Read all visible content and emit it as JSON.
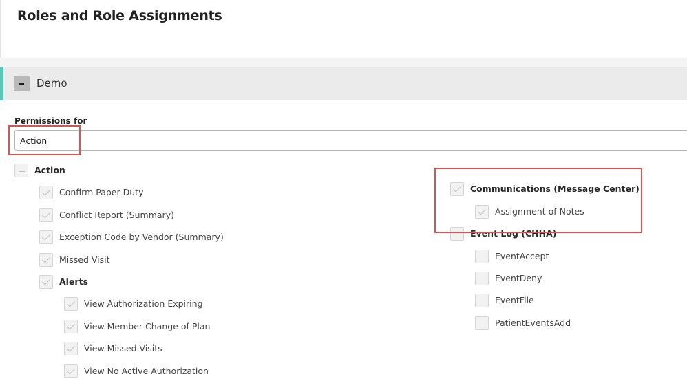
{
  "page": {
    "title": "Roles and Role Assignments"
  },
  "section": {
    "title": "Demo"
  },
  "permissions": {
    "label": "Permissions for",
    "selected": "Action"
  },
  "tree_left": {
    "action": {
      "label": "Action",
      "items": [
        {
          "label": "Confirm Paper Duty",
          "checked": true
        },
        {
          "label": "Conflict Report (Summary)",
          "checked": true
        },
        {
          "label": "Exception Code by Vendor (Summary)",
          "checked": true
        },
        {
          "label": "Missed Visit",
          "checked": true
        }
      ],
      "alerts": {
        "label": "Alerts",
        "items": [
          {
            "label": "View Authorization Expiring",
            "checked": true
          },
          {
            "label": "View Member Change of Plan",
            "checked": true
          },
          {
            "label": "View Missed Visits",
            "checked": true
          },
          {
            "label": "View No Active Authorization",
            "checked": true
          }
        ]
      }
    }
  },
  "tree_right": {
    "communications": {
      "label": "Communications (Message Center)",
      "items": [
        {
          "label": "Assignment of Notes",
          "checked": true
        }
      ]
    },
    "event_log": {
      "label": "Event Log (CHHA)",
      "items": [
        {
          "label": "EventAccept",
          "checked": false
        },
        {
          "label": "EventDeny",
          "checked": false
        },
        {
          "label": "EventFile",
          "checked": false
        },
        {
          "label": "PatientEventsAdd",
          "checked": false
        }
      ]
    }
  },
  "colors": {
    "accent": "#5cc8b8",
    "highlight": "#d9534f"
  }
}
